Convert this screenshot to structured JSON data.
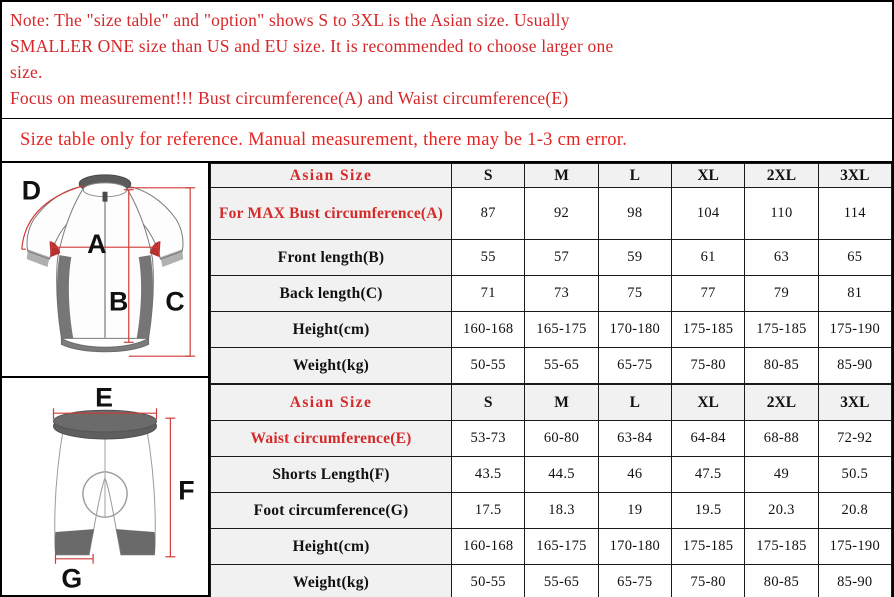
{
  "notes": {
    "lines": [
      "Note: The \"size table\" and \"option\" shows S to 3XL is the Asian size. Usually",
      "SMALLER ONE size than US and EU size. It is recommended to choose larger one",
      "size.",
      "Focus on measurement!!! Bust circumference(A) and Waist circumference(E)"
    ],
    "reference": "Size table only for reference. Manual measurement, there may be 1-3 cm error."
  },
  "illustrations": {
    "jersey": {
      "name": "cycling-jersey-diagram",
      "labels": [
        "D",
        "A",
        "B",
        "C"
      ]
    },
    "shorts": {
      "name": "cycling-shorts-diagram",
      "labels": [
        "E",
        "F",
        "G"
      ]
    }
  },
  "colors": {
    "note_red": "#d5272a",
    "reference_red": "#e8221f",
    "label_red": "#d42a2a",
    "header_bg": "#f1f1f1",
    "border": "#1a1a1a",
    "accent_red": "#c0392b",
    "fabric_gray": "#606060"
  },
  "table_top": {
    "sizes": [
      "S",
      "M",
      "L",
      "XL",
      "2XL",
      "3XL"
    ],
    "size_header_label": "Asian Size",
    "rows": [
      {
        "label": "For MAX Bust circumference(A)",
        "red": true,
        "values": [
          "87",
          "92",
          "98",
          "104",
          "110",
          "114"
        ]
      },
      {
        "label": "Front length(B)",
        "red": false,
        "values": [
          "55",
          "57",
          "59",
          "61",
          "63",
          "65"
        ]
      },
      {
        "label": "Back length(C)",
        "red": false,
        "values": [
          "71",
          "73",
          "75",
          "77",
          "79",
          "81"
        ]
      },
      {
        "label": "Height(cm)",
        "red": false,
        "values": [
          "160-168",
          "165-175",
          "170-180",
          "175-185",
          "175-185",
          "175-190"
        ]
      },
      {
        "label": "Weight(kg)",
        "red": false,
        "values": [
          "50-55",
          "55-65",
          "65-75",
          "75-80",
          "80-85",
          "85-90"
        ]
      }
    ]
  },
  "table_bottom": {
    "sizes": [
      "S",
      "M",
      "L",
      "XL",
      "2XL",
      "3XL"
    ],
    "size_header_label": "Asian Size",
    "rows": [
      {
        "label": "Waist circumference(E)",
        "red": true,
        "values": [
          "53-73",
          "60-80",
          "63-84",
          "64-84",
          "68-88",
          "72-92"
        ]
      },
      {
        "label": "Shorts Length(F)",
        "red": false,
        "values": [
          "43.5",
          "44.5",
          "46",
          "47.5",
          "49",
          "50.5"
        ]
      },
      {
        "label": "Foot circumference(G)",
        "red": false,
        "values": [
          "17.5",
          "18.3",
          "19",
          "19.5",
          "20.3",
          "20.8"
        ]
      },
      {
        "label": "Height(cm)",
        "red": false,
        "values": [
          "160-168",
          "165-175",
          "170-180",
          "175-185",
          "175-185",
          "175-190"
        ]
      },
      {
        "label": "Weight(kg)",
        "red": false,
        "values": [
          "50-55",
          "55-65",
          "65-75",
          "75-80",
          "80-85",
          "85-90"
        ]
      }
    ]
  }
}
